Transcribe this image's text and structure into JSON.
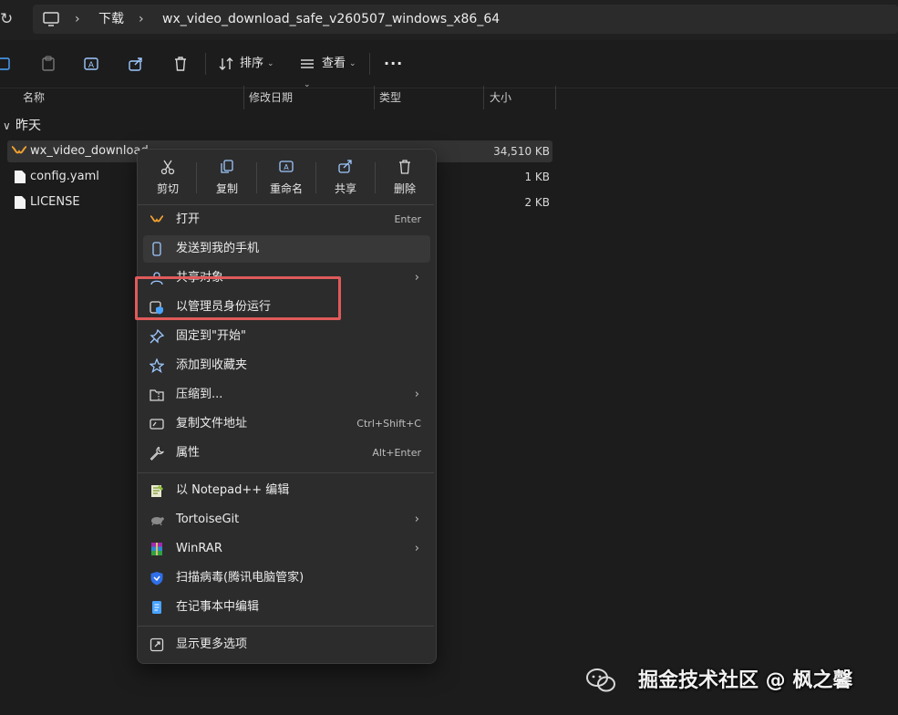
{
  "address": {
    "segments": [
      "下载",
      "wx_video_download_safe_v260507_windows_x86_64"
    ]
  },
  "toolbar": {
    "sort_label": "排序",
    "view_label": "查看",
    "more_label": "···"
  },
  "columns": {
    "name": "名称",
    "date": "修改日期",
    "type": "类型",
    "size": "大小"
  },
  "group": {
    "label": "昨天"
  },
  "files": [
    {
      "name": "wx_video_download.",
      "size": "34,510 KB",
      "icon": "app-icon"
    },
    {
      "name": "config.yaml",
      "size": "1 KB",
      "icon": "file-icon"
    },
    {
      "name": "LICENSE",
      "size": "2 KB",
      "icon": "file-icon"
    }
  ],
  "menu": {
    "quick_actions": [
      "剪切",
      "复制",
      "重命名",
      "共享",
      "删除"
    ],
    "items": [
      {
        "label": "打开",
        "shortcut": "Enter"
      },
      {
        "label": "发送到我的手机",
        "shortcut": ""
      },
      {
        "label": "共享对象",
        "shortcut": ""
      },
      {
        "label": "以管理员身份运行",
        "shortcut": ""
      },
      {
        "label": "固定到\"开始\"",
        "shortcut": ""
      },
      {
        "label": "添加到收藏夹",
        "shortcut": ""
      },
      {
        "label": "压缩到...",
        "shortcut": ""
      },
      {
        "label": "复制文件地址",
        "shortcut": "Ctrl+Shift+C"
      },
      {
        "label": "属性",
        "shortcut": "Alt+Enter"
      },
      {
        "label": "以 Notepad++ 编辑",
        "shortcut": ""
      },
      {
        "label": "TortoiseGit",
        "shortcut": ""
      },
      {
        "label": "WinRAR",
        "shortcut": ""
      },
      {
        "label": "扫描病毒(腾讯电脑管家)",
        "shortcut": ""
      },
      {
        "label": "在记事本中编辑",
        "shortcut": ""
      },
      {
        "label": "显示更多选项",
        "shortcut": ""
      }
    ]
  },
  "watermark": {
    "text": "掘金技术社区 @ 枫之馨"
  },
  "colors": {
    "accent": "#4aa3ff",
    "highlight_box": "#e05a5a",
    "menu_bg": "#2c2c2c"
  }
}
